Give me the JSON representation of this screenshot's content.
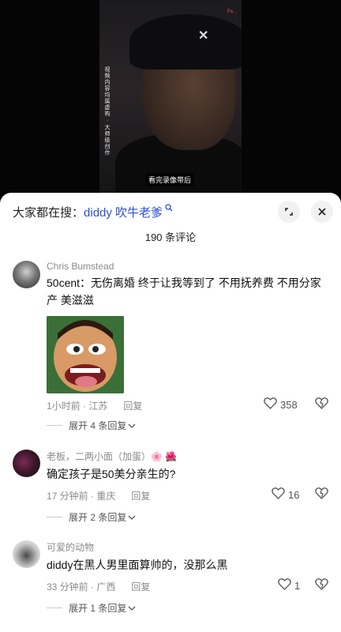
{
  "video": {
    "watermark": "Pa...",
    "vertical_text": "视频内容均属虚构 · 大师级创作",
    "subtitle": "看完录像带后"
  },
  "sheet": {
    "search_prefix": "大家都在搜：",
    "search_keyword": "diddy 吹牛老爹",
    "search_icon": "search-icon",
    "fullscreen_icon": "expand-icon",
    "close_icon": "close-icon",
    "comment_count": "190 条评论"
  },
  "comments": [
    {
      "user": "Chris  Bumstead",
      "text": "50cent：无伤离婚 终于让我等到了 不用抚养费 不用分家产 美滋滋",
      "has_sticker": true,
      "meta": "1小时前 · 江苏",
      "reply": "回复",
      "likes": "358",
      "expand": "展开 4 条回复"
    },
    {
      "user": "老板，二两小面（加蛋）🌸 🌺",
      "text": "确定孩子是50美分亲生的?",
      "meta": "17 分钟前 · 重庆",
      "reply": "回复",
      "likes": "16",
      "expand": "展开 2 条回复"
    },
    {
      "user": "可爱的动物",
      "text": "diddy在黑人男里面算帅的，没那么黑",
      "meta": "33 分钟前 · 广西",
      "reply": "回复",
      "likes": "1",
      "expand": "展开 1 条回复"
    }
  ]
}
